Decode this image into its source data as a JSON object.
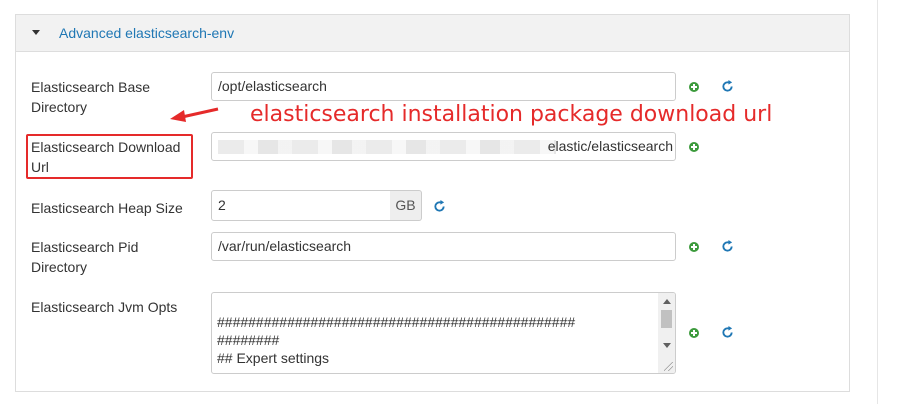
{
  "panel": {
    "title": "Advanced elasticsearch-env"
  },
  "fields": {
    "base_dir": {
      "label": "Elasticsearch Base Directory",
      "value": "/opt/elasticsearch"
    },
    "download_url": {
      "label": "Elasticsearch Download Url",
      "value_tail": "elastic/elasticsearch"
    },
    "heap_size": {
      "label": "Elasticsearch Heap Size",
      "value": "2",
      "unit": "GB"
    },
    "pid_dir": {
      "label": "Elasticsearch Pid Directory",
      "value": "/var/run/elasticsearch"
    },
    "jvm_opts": {
      "label": "Elasticsearch Jvm Opts",
      "lines": [
        "##############################################",
        "########",
        "## Expert settings"
      ]
    }
  },
  "annotation": {
    "text": "elasticsearch installation package download url",
    "color": "#e52a2a"
  },
  "icons": {
    "add": "plus-circle-icon",
    "reset": "refresh-icon"
  },
  "colors": {
    "link": "#1f77b4",
    "add_icon": "#3c9a3c",
    "reset_icon": "#1f77b4"
  }
}
